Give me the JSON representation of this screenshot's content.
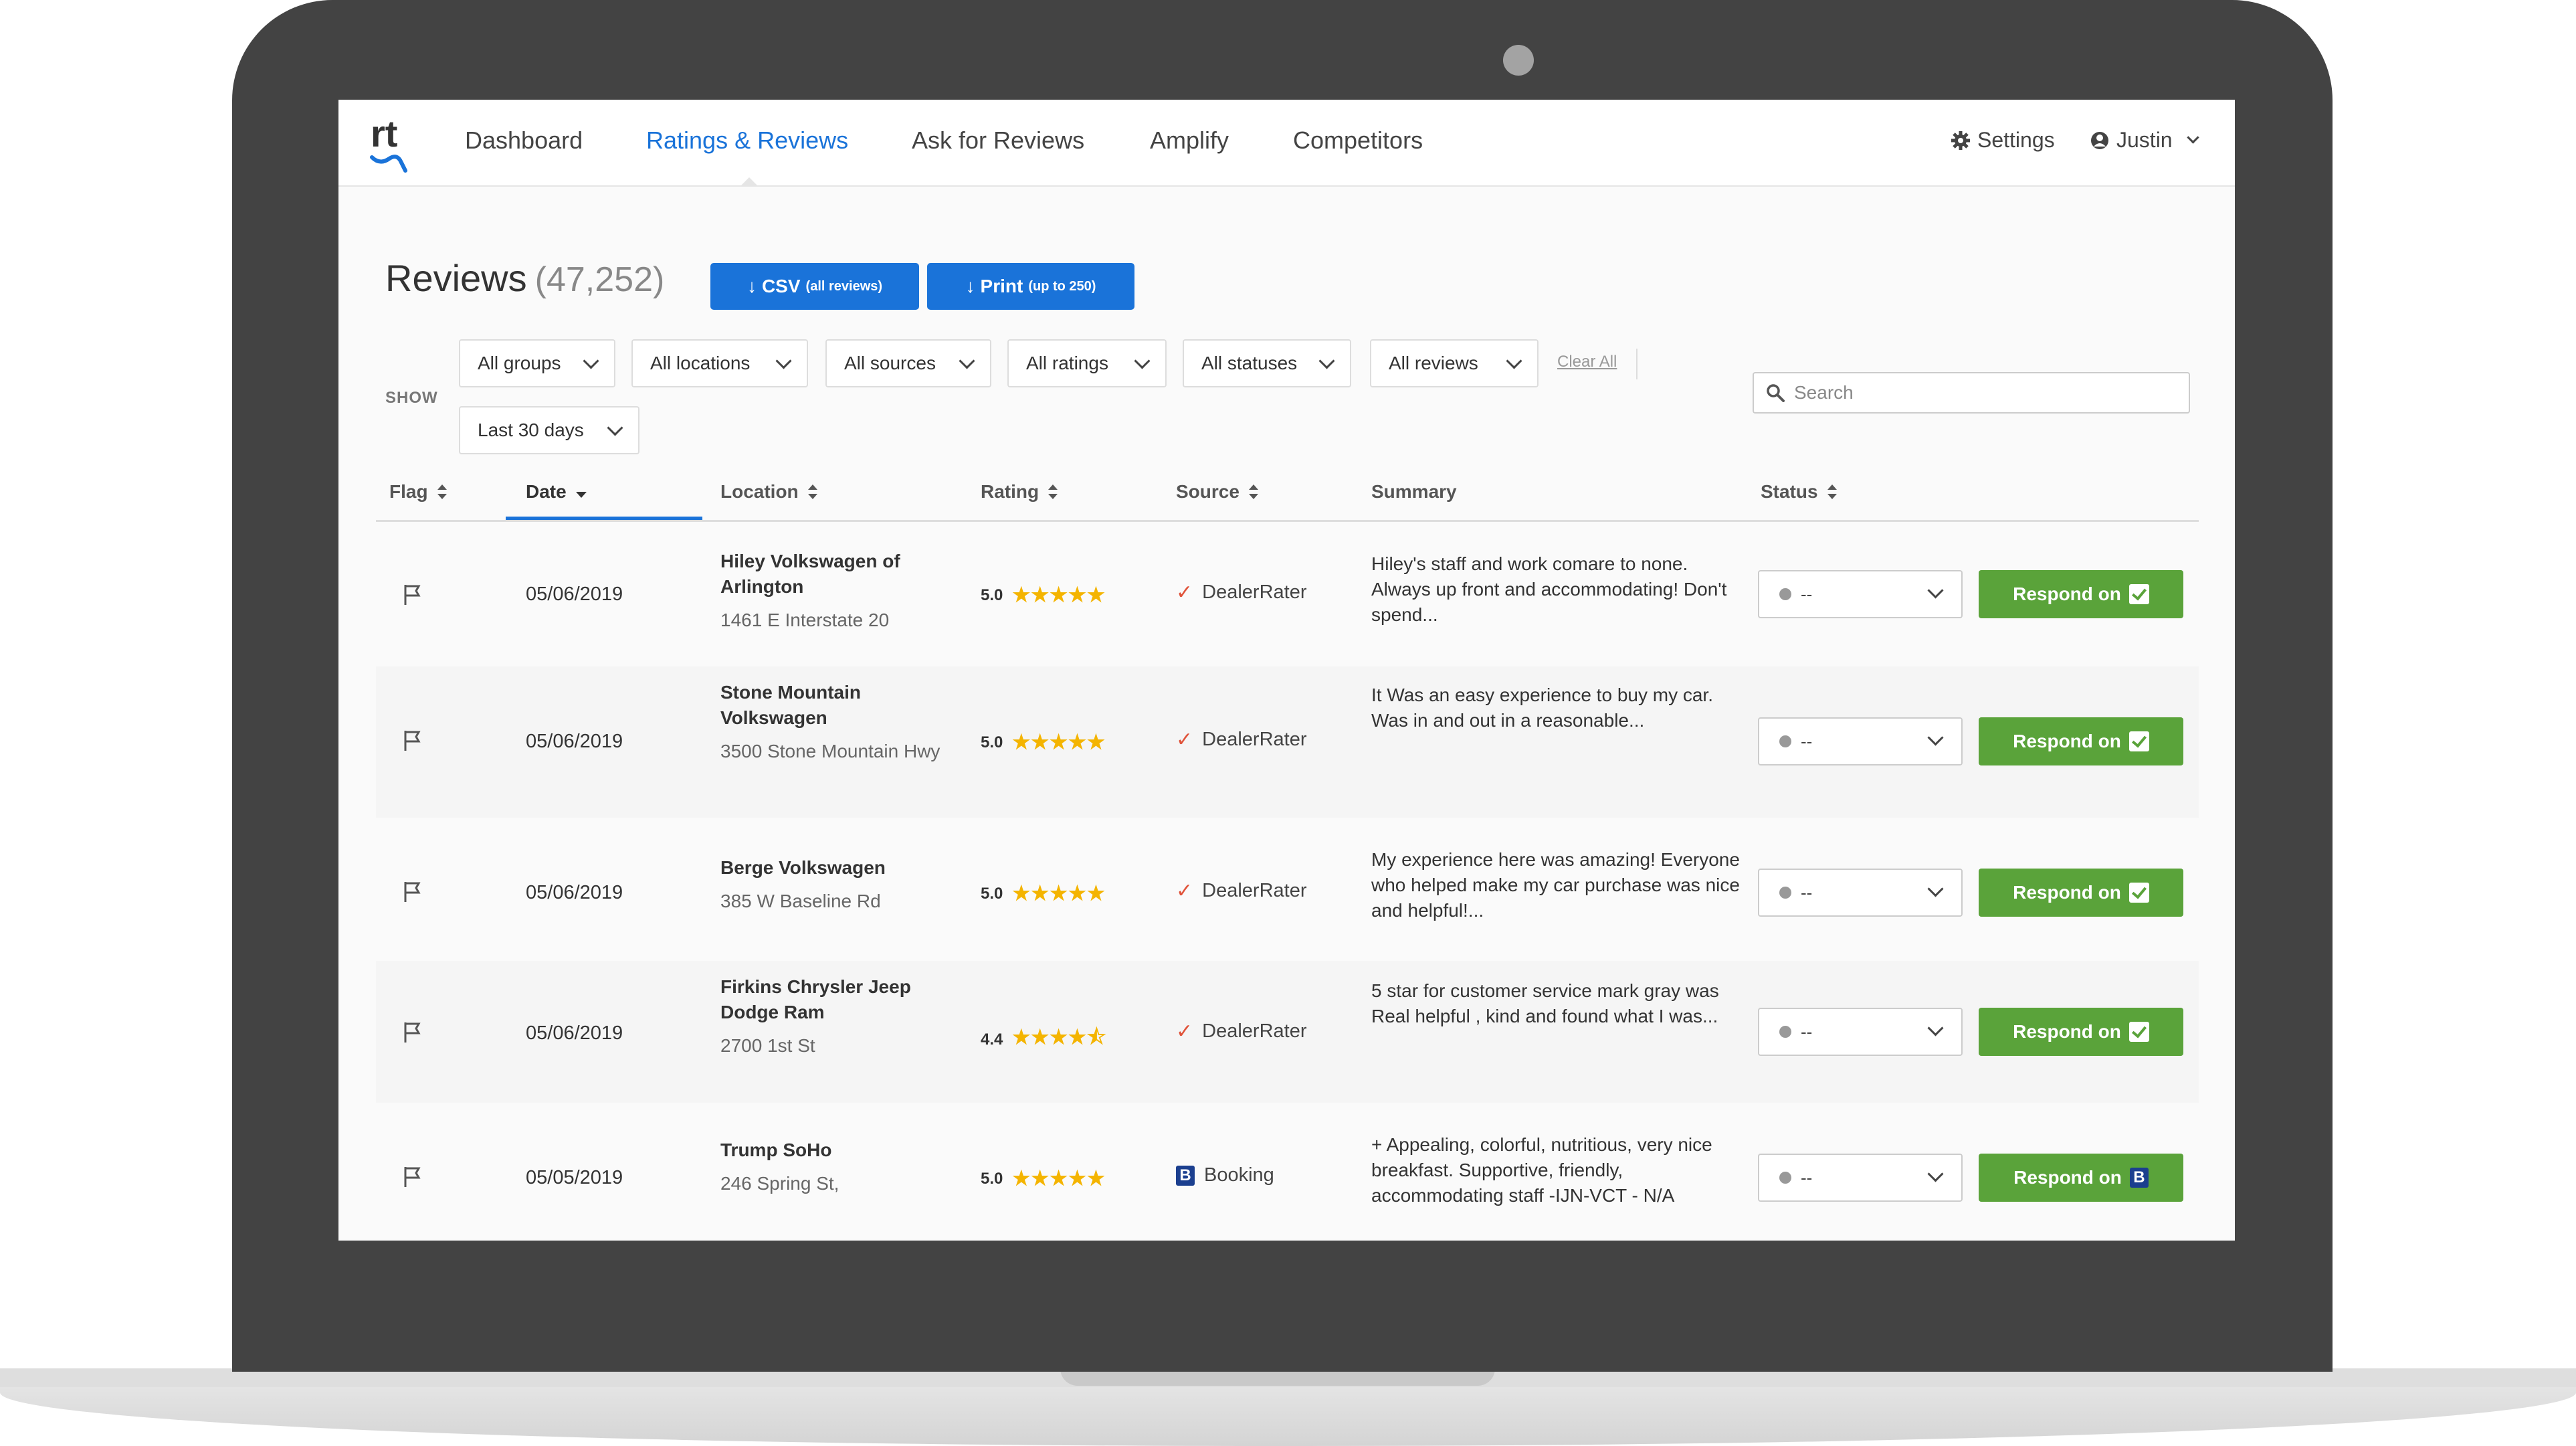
{
  "nav": {
    "items": [
      {
        "label": "Dashboard"
      },
      {
        "label": "Ratings & Reviews"
      },
      {
        "label": "Ask for Reviews"
      },
      {
        "label": "Amplify"
      },
      {
        "label": "Competitors"
      }
    ],
    "settings_label": "Settings",
    "user_label": "Justin",
    "active_color": "#1a73d9"
  },
  "page": {
    "title": "Reviews",
    "count": "(47,252)",
    "csv_label": "CSV",
    "csv_note": "(all reviews)",
    "print_label": "Print",
    "print_note": "(up to 250)"
  },
  "filters": {
    "show_label": "SHOW",
    "groups": "All groups",
    "locations": "All locations",
    "sources": "All sources",
    "ratings": "All ratings",
    "statuses": "All statuses",
    "reviews": "All reviews",
    "clear_all": "Clear All",
    "date_range": "Last 30 days",
    "search_placeholder": "Search"
  },
  "table": {
    "headers": {
      "flag": "Flag",
      "date": "Date",
      "location": "Location",
      "rating": "Rating",
      "source": "Source",
      "summary": "Summary",
      "status": "Status"
    },
    "respond_label": "Respond on",
    "rows": [
      {
        "date": "05/06/2019",
        "location_name": "Hiley Volkswagen of Arlington",
        "location_address": "1461 E Interstate 20",
        "rating": "5.0",
        "stars": "★★★★★",
        "source": "DealerRater",
        "summary": "Hiley's staff and work comare to none. Always up front and accommodating! Don't spend...",
        "status": "--"
      },
      {
        "date": "05/06/2019",
        "location_name": "Stone Mountain Volkswagen",
        "location_address": "3500 Stone Mountain Hwy",
        "rating": "5.0",
        "stars": "★★★★★",
        "source": "DealerRater",
        "summary": "It Was an easy experience to buy my car. Was in and out in a reasonable...",
        "status": "--"
      },
      {
        "date": "05/06/2019",
        "location_name": "Berge Volkswagen",
        "location_address": "385 W Baseline Rd",
        "rating": "5.0",
        "stars": "★★★★★",
        "source": "DealerRater",
        "summary": "My experience here was amazing! Everyone who helped make my car purchase was nice and helpful!...",
        "status": "--"
      },
      {
        "date": "05/06/2019",
        "location_name": "Firkins Chrysler Jeep Dodge Ram",
        "location_address": "2700 1st St",
        "rating": "4.4",
        "stars": "★★★★⯪",
        "source": "DealerRater",
        "summary": "5 star for customer service mark gray was Real helpful , kind and found what I was...",
        "status": "--"
      },
      {
        "date": "05/05/2019",
        "location_name": "Trump SoHo",
        "location_address": "246 Spring St,",
        "rating": "5.0",
        "stars": "★★★★★",
        "source": "Booking",
        "summary": "+ Appealing, colorful, nutritious, very nice breakfast. Supportive, friendly, accommodating staff -IJN-VCT - N/A",
        "status": "--"
      }
    ]
  },
  "icons": {
    "logo": "rt-logo",
    "settings": "gear-icon",
    "user": "user-circle-icon",
    "flag": "flag-icon",
    "search": "search-icon",
    "dealerrater": "checkmark-icon",
    "booking": "booking-b-icon"
  }
}
